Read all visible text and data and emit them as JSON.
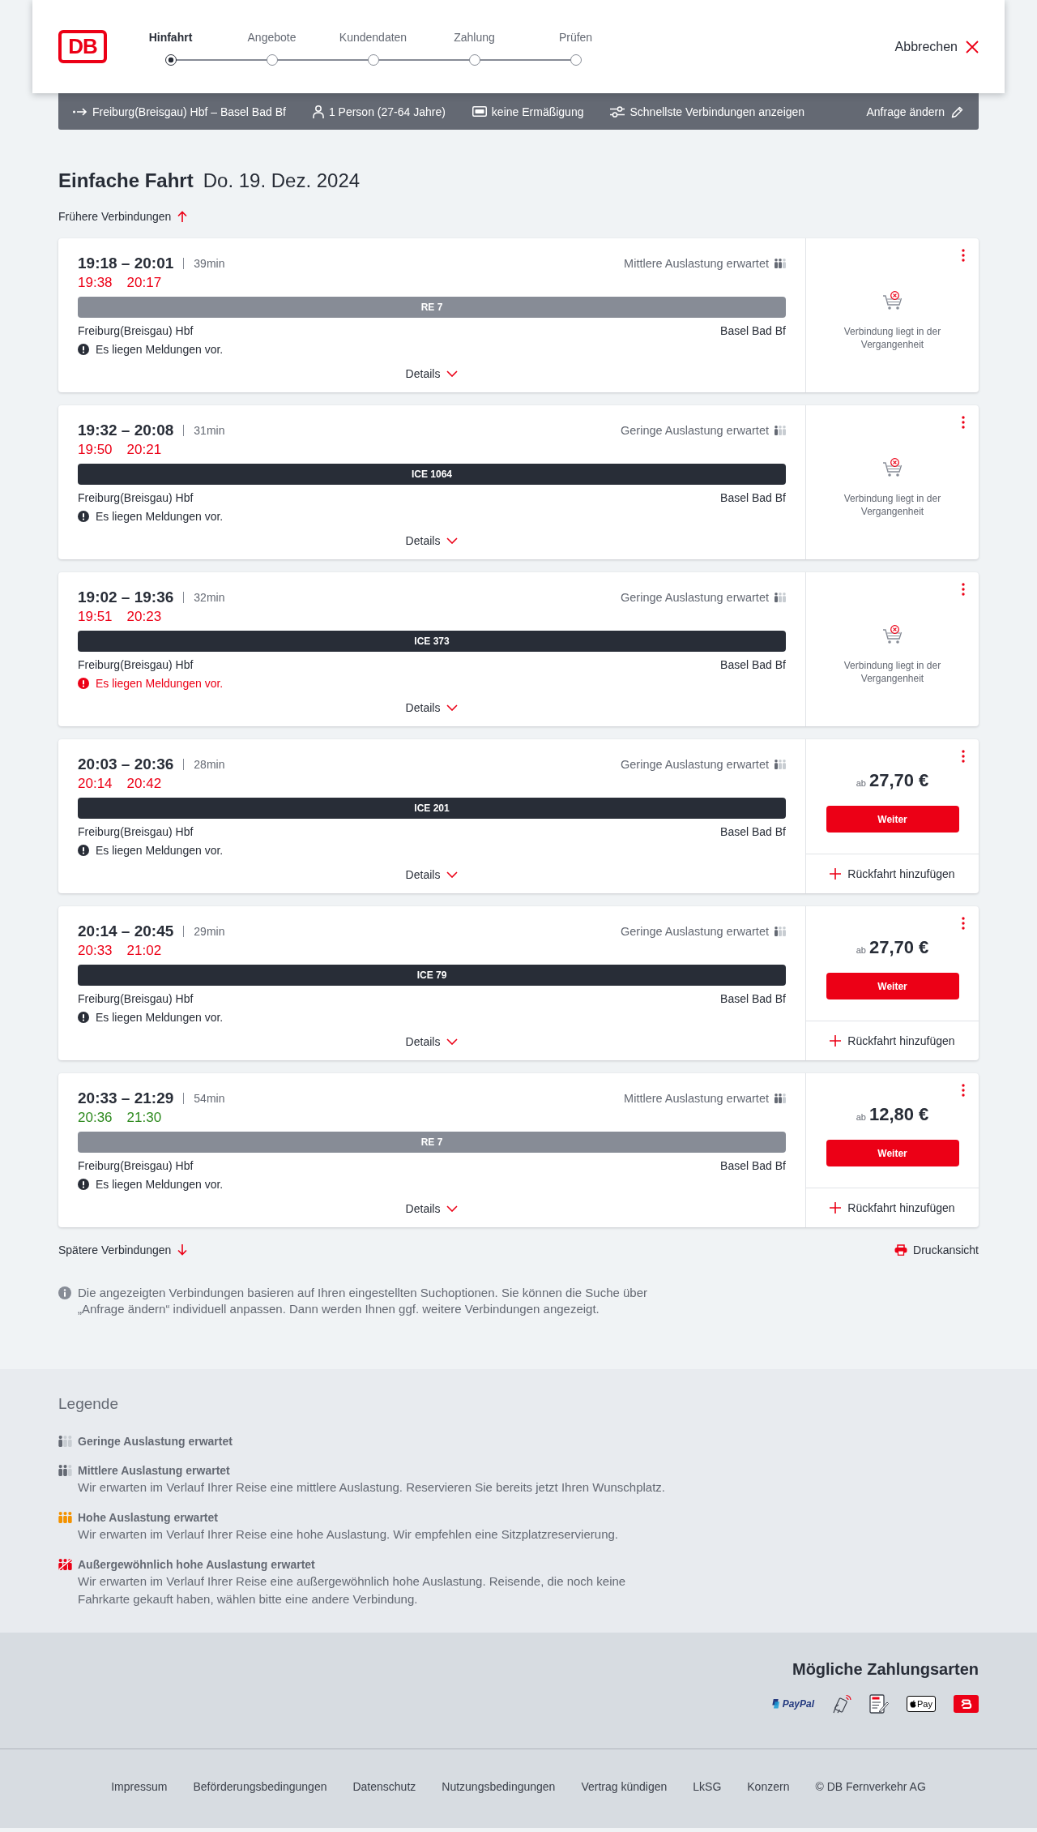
{
  "header": {
    "logo": "DB",
    "steps": [
      {
        "label": "Hinfahrt",
        "selected": true
      },
      {
        "label": "Angebote",
        "selected": false
      },
      {
        "label": "Kundendaten",
        "selected": false
      },
      {
        "label": "Zahlung",
        "selected": false
      },
      {
        "label": "Prüfen",
        "selected": false
      }
    ],
    "cancel": "Abbrechen"
  },
  "search_summary": {
    "route": "Freiburg(Breisgau) Hbf – Basel Bad Bf",
    "passengers": "1 Person (27-64 Jahre)",
    "discount": "keine Ermäßigung",
    "filter": "Schnellste Verbindungen anzeigen",
    "edit": "Anfrage ändern"
  },
  "heading": {
    "title": "Einfache Fahrt",
    "date": "Do. 19. Dez. 2024"
  },
  "earlier_link": "Frühere Verbindungen",
  "connections": [
    {
      "times": "19:18 – 20:01",
      "duration": "39min",
      "occupancy": {
        "kind": "medium",
        "text": "Mittlere Auslastung erwartet"
      },
      "realtime": [
        {
          "time": "19:38",
          "delayed": true
        },
        {
          "time": "20:17",
          "delayed": true
        }
      ],
      "train": {
        "label": "RE 7",
        "kind": "regional"
      },
      "from": "Freiburg(Breisgau) Hbf",
      "to": "Basel Bad Bf",
      "message": {
        "kind": "info",
        "text": "Es liegen Meldungen vor."
      },
      "details": "Details",
      "offer": {
        "kind": "past",
        "text": "Verbindung liegt in der Vergangenheit"
      }
    },
    {
      "times": "19:32 – 20:08",
      "duration": "31min",
      "occupancy": {
        "kind": "low",
        "text": "Geringe Auslastung erwartet"
      },
      "realtime": [
        {
          "time": "19:50",
          "delayed": true
        },
        {
          "time": "20:21",
          "delayed": true
        }
      ],
      "train": {
        "label": "ICE 1064",
        "kind": "long_distance"
      },
      "from": "Freiburg(Breisgau) Hbf",
      "to": "Basel Bad Bf",
      "message": {
        "kind": "info",
        "text": "Es liegen Meldungen vor."
      },
      "details": "Details",
      "offer": {
        "kind": "past",
        "text": "Verbindung liegt in der Vergangenheit"
      }
    },
    {
      "times": "19:02 – 19:36",
      "duration": "32min",
      "occupancy": {
        "kind": "low",
        "text": "Geringe Auslastung erwartet"
      },
      "realtime": [
        {
          "time": "19:51",
          "delayed": true
        },
        {
          "time": "20:23",
          "delayed": true
        }
      ],
      "train": {
        "label": "ICE 373",
        "kind": "long_distance"
      },
      "from": "Freiburg(Breisgau) Hbf",
      "to": "Basel Bad Bf",
      "message": {
        "kind": "alert",
        "text": "Es liegen Meldungen vor."
      },
      "details": "Details",
      "offer": {
        "kind": "past",
        "text": "Verbindung liegt in der Vergangenheit"
      }
    },
    {
      "times": "20:03 – 20:36",
      "duration": "28min",
      "occupancy": {
        "kind": "low",
        "text": "Geringe Auslastung erwartet"
      },
      "realtime": [
        {
          "time": "20:14",
          "delayed": true
        },
        {
          "time": "20:42",
          "delayed": true
        }
      ],
      "train": {
        "label": "ICE 201",
        "kind": "long_distance"
      },
      "from": "Freiburg(Breisgau) Hbf",
      "to": "Basel Bad Bf",
      "message": {
        "kind": "info",
        "text": "Es liegen Meldungen vor."
      },
      "details": "Details",
      "offer": {
        "kind": "price",
        "prefix": "ab",
        "price": "27,70 €",
        "button": "Weiter",
        "return_trip": "Rückfahrt hinzufügen"
      }
    },
    {
      "times": "20:14 – 20:45",
      "duration": "29min",
      "occupancy": {
        "kind": "low",
        "text": "Geringe Auslastung erwartet"
      },
      "realtime": [
        {
          "time": "20:33",
          "delayed": true
        },
        {
          "time": "21:02",
          "delayed": true
        }
      ],
      "train": {
        "label": "ICE 79",
        "kind": "long_distance"
      },
      "from": "Freiburg(Breisgau) Hbf",
      "to": "Basel Bad Bf",
      "message": {
        "kind": "info",
        "text": "Es liegen Meldungen vor."
      },
      "details": "Details",
      "offer": {
        "kind": "price",
        "prefix": "ab",
        "price": "27,70 €",
        "button": "Weiter",
        "return_trip": "Rückfahrt hinzufügen"
      }
    },
    {
      "times": "20:33 – 21:29",
      "duration": "54min",
      "occupancy": {
        "kind": "medium",
        "text": "Mittlere Auslastung erwartet"
      },
      "realtime": [
        {
          "time": "20:36",
          "delayed": false
        },
        {
          "time": "21:30",
          "delayed": false
        }
      ],
      "train": {
        "label": "RE 7",
        "kind": "regional"
      },
      "from": "Freiburg(Breisgau) Hbf",
      "to": "Basel Bad Bf",
      "message": {
        "kind": "info",
        "text": "Es liegen Meldungen vor."
      },
      "details": "Details",
      "offer": {
        "kind": "price",
        "prefix": "ab",
        "price": "12,80 €",
        "button": "Weiter",
        "return_trip": "Rückfahrt hinzufügen"
      }
    }
  ],
  "later_link": "Spätere Verbindungen",
  "print_link": "Druckansicht",
  "note": "Die angezeigten Verbindungen basieren auf Ihren eingestellten Suchoptionen. Sie können die Suche über „Anfrage ändern“ individuell anpassen. Dann werden Ihnen ggf. weitere Verbindungen angezeigt.",
  "legend": {
    "title": "Legende",
    "items": [
      {
        "kind": "low",
        "title": "Geringe Auslastung erwartet"
      },
      {
        "kind": "medium",
        "title": "Mittlere Auslastung erwartet",
        "description": "Wir erwarten im Verlauf Ihrer Reise eine mittlere Auslastung. Reservieren Sie bereits jetzt Ihren Wunschplatz."
      },
      {
        "kind": "high",
        "title": "Hohe Auslastung erwartet",
        "description": "Wir erwarten im Verlauf Ihrer Reise eine hohe Auslastung. Wir empfehlen eine Sitzplatzreservierung."
      },
      {
        "kind": "extreme",
        "title": "Außergewöhnlich hohe Auslastung erwartet",
        "description": "Wir erwarten im Verlauf Ihrer Reise eine außergewöhnlich hohe Auslastung. Reisende, die noch keine Fahrkarte gekauft haben, wählen bitte eine andere Verbindung."
      }
    ]
  },
  "payment": {
    "title": "Mögliche Zahlungsarten",
    "methods": [
      {
        "kind": "paypal",
        "label": "PayPal"
      },
      {
        "kind": "contactless_card"
      },
      {
        "kind": "sepa"
      },
      {
        "kind": "apple_pay",
        "label": "Pay"
      },
      {
        "kind": "app_tile"
      }
    ]
  },
  "footer": {
    "links": [
      "Impressum",
      "Beförderungsbedingungen",
      "Datenschutz",
      "Nutzungsbedingungen",
      "Vertrag kündigen",
      "LkSG",
      "Konzern"
    ],
    "copyright": "© DB Fernverkehr AG"
  }
}
